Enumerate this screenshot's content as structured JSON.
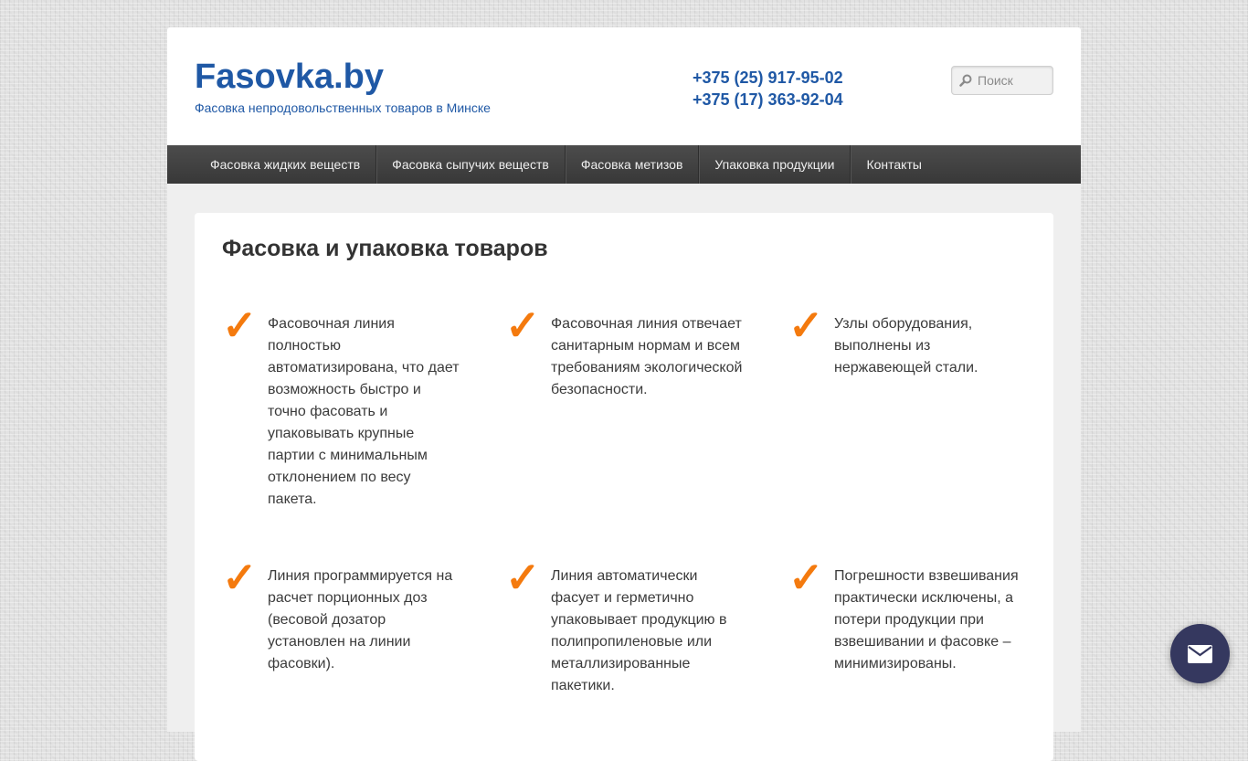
{
  "header": {
    "site_title": "Fasovka.by",
    "site_description": "Фасовка непродовольственных товаров в Минске",
    "phones": [
      "+375 (25) 917-95-02",
      "+375 (17) 363-92-04"
    ],
    "search": {
      "placeholder": "Поиск",
      "icon": "search-icon"
    }
  },
  "nav": {
    "items": [
      "Фасовка жидких веществ",
      "Фасовка сыпучих веществ",
      "Фасовка метизов",
      "Упаковка продукции",
      "Контакты"
    ]
  },
  "main": {
    "title": "Фасовка и упаковка товаров",
    "check_glyph": "✓",
    "features": [
      "Фасовочная линия полностью автоматизирована, что дает возможность быстро и точно фасовать и упаковывать крупные партии с минимальным отклонением по весу пакета.",
      "Фасовочная линия отвечает санитарным нормам и всем требованиям экологической безопасности.",
      "Узлы оборудования, выполнены из нержавеющей стали.",
      "Линия программируется на расчет порционных доз (весовой дозатор установлен на линии фасовки).",
      "Линия автоматически фасует и герметично упаковывает продукцию в полипропиленовые или металлизированные пакетики.",
      "Погрешности взвешивания практически исключены, а потери продукции при взвешивании и фасовке – минимизированы."
    ]
  },
  "floating": {
    "icon": "mail-icon"
  },
  "colors": {
    "brand_blue": "#1f58a5",
    "check_orange": "#f47a0e",
    "nav_bg": "#404040",
    "fab_bg": "#35385f"
  }
}
